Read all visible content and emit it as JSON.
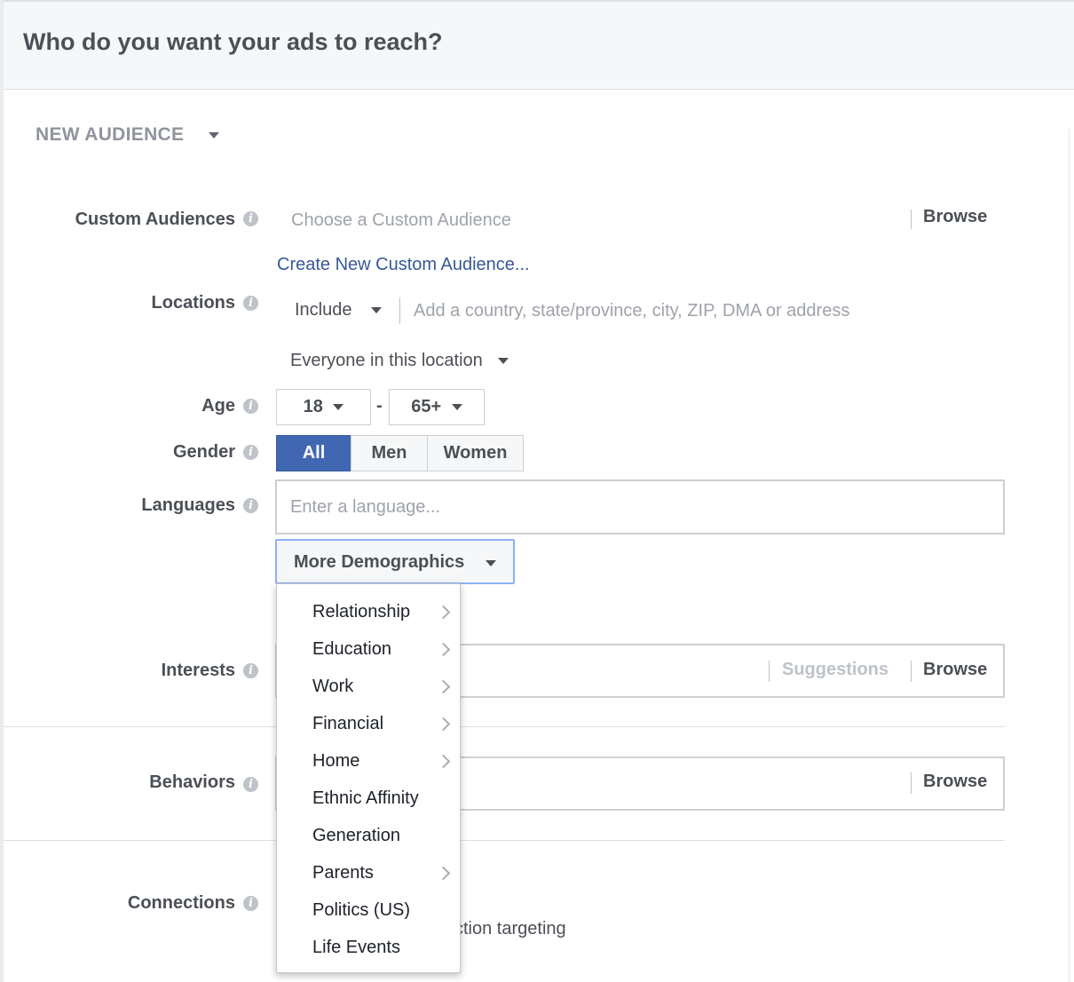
{
  "header": {
    "title": "Who do you want your ads to reach?"
  },
  "audience_selector": {
    "label": "NEW AUDIENCE"
  },
  "custom_audiences": {
    "label": "Custom Audiences",
    "placeholder": "Choose a Custom Audience",
    "browse_label": "Browse",
    "create_link": "Create New Custom Audience..."
  },
  "locations": {
    "label": "Locations",
    "include_value": "Include",
    "placeholder": "Add a country, state/province, city, ZIP, DMA or address",
    "scope_value": "Everyone in this location"
  },
  "age": {
    "label": "Age",
    "min": "18",
    "separator": "-",
    "max": "65+"
  },
  "gender": {
    "label": "Gender",
    "options": [
      "All",
      "Men",
      "Women"
    ],
    "selected": "All"
  },
  "languages": {
    "label": "Languages",
    "placeholder": "Enter a language..."
  },
  "more_demographics": {
    "label": "More Demographics",
    "menu": [
      {
        "label": "Relationship",
        "submenu": true
      },
      {
        "label": "Education",
        "submenu": true
      },
      {
        "label": "Work",
        "submenu": true
      },
      {
        "label": "Financial",
        "submenu": true
      },
      {
        "label": "Home",
        "submenu": true
      },
      {
        "label": "Ethnic Affinity",
        "submenu": false
      },
      {
        "label": "Generation",
        "submenu": false
      },
      {
        "label": "Parents",
        "submenu": true
      },
      {
        "label": "Politics (US)",
        "submenu": false
      },
      {
        "label": "Life Events",
        "submenu": false
      }
    ]
  },
  "interests": {
    "label": "Interests",
    "suggestions_label": "Suggestions",
    "browse_label": "Browse"
  },
  "behaviors": {
    "label": "Behaviors",
    "browse_label": "Browse"
  },
  "connections": {
    "label": "Connections",
    "partial_text": "ction targeting"
  },
  "colors": {
    "accent": "#4267b2",
    "link": "#365899",
    "focus": "#8fb1f5"
  }
}
